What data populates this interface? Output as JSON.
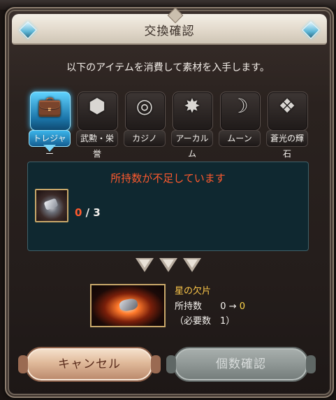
{
  "dialog": {
    "title": "交換確認",
    "instruction": "以下のアイテムを消費して素材を入手します。"
  },
  "tabs": [
    {
      "label": "トレジャー",
      "icon": "treasure-chest-icon",
      "active": true
    },
    {
      "label": "武勲・栄誉",
      "icon": "medals-icon",
      "active": false
    },
    {
      "label": "カジノ",
      "icon": "casino-chip-icon",
      "active": false
    },
    {
      "label": "アーカルム",
      "icon": "arcarum-star-icon",
      "active": false
    },
    {
      "label": "ムーン",
      "icon": "moon-icon",
      "active": false
    },
    {
      "label": "蒼光の輝石",
      "icon": "crystal-icon",
      "active": false
    }
  ],
  "requirement": {
    "warning": "所持数が不足しています",
    "have": "0",
    "separator": "/",
    "need": "3"
  },
  "result": {
    "name": "星の欠片",
    "owned_label": "所持数",
    "owned_before": "0",
    "arrow": "→",
    "owned_after": "0",
    "required_text": "（必要数　1）"
  },
  "buttons": {
    "cancel": "キャンセル",
    "confirm": "個数確認"
  },
  "colors": {
    "warning": "#ff5a2e",
    "result_name": "#ffc94a",
    "active_tab": "#3bb4ea"
  }
}
